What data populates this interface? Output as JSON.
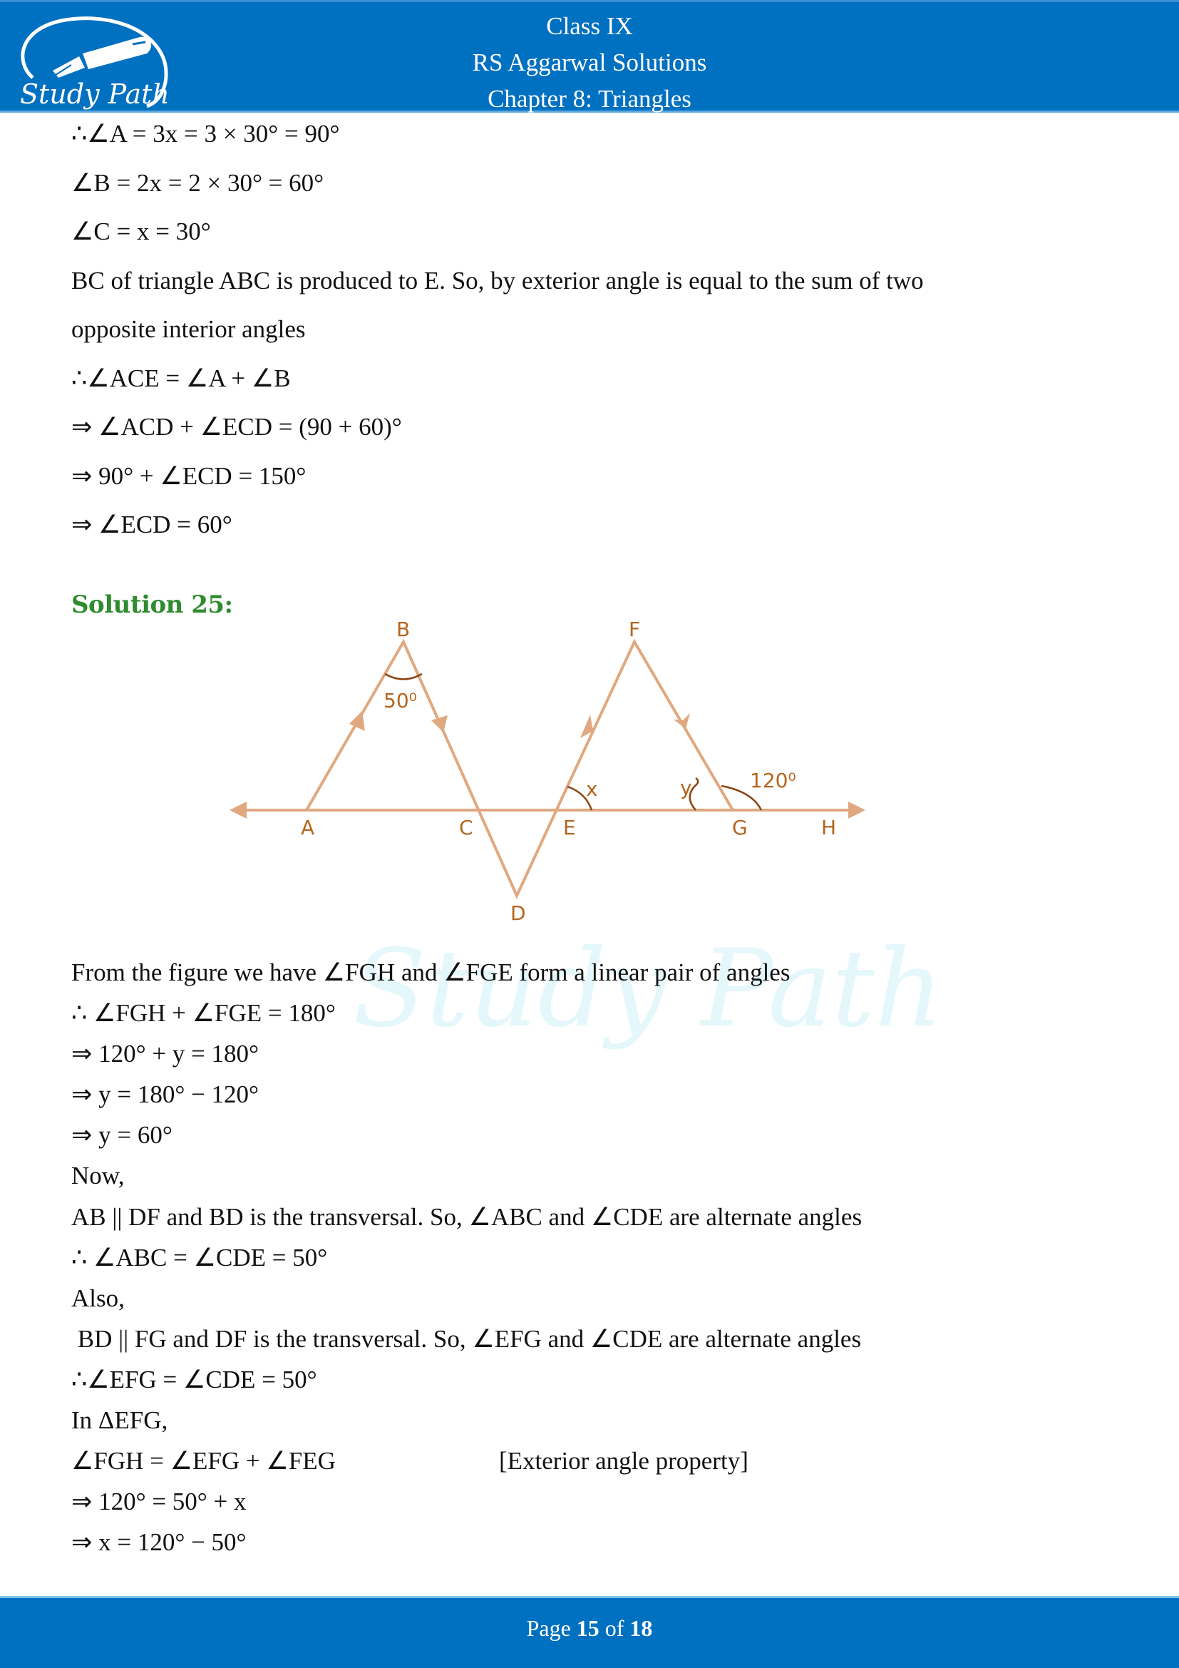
{
  "header": {
    "logo_text": "Study Path",
    "logo_icon": "fountain-pen-icon",
    "title_lines": [
      "Class IX",
      "RS Aggarwal Solutions",
      "Chapter 8: Triangles"
    ]
  },
  "previous_solution_lines": [
    "∴∠A = 3x = 3 × 30° = 90°",
    "∠B = 2x = 2 × 30° = 60°",
    "∠C = x = 30°",
    "BC of triangle ABC is produced to E. So, by exterior angle is equal to the sum of two",
    "opposite interior angles",
    "∴∠ACE = ∠A + ∠B",
    "⇒ ∠ACD + ∠ECD = (90 + 60)°",
    "⇒ 90° + ∠ECD = 150°",
    "⇒ ∠ECD = 60°"
  ],
  "solution": {
    "heading": "Solution 25:",
    "heading_color": "#2e8b2e",
    "figure": {
      "stroke_color": "#e0a880",
      "label_color": "#b5651d",
      "points": [
        "A",
        "B",
        "C",
        "D",
        "E",
        "F",
        "G",
        "H"
      ],
      "angle_labels": {
        "B": "50⁰",
        "E": "x",
        "G_interior": "y",
        "G_exterior": "120⁰"
      }
    },
    "lines": [
      "From the figure we have ∠FGH and ∠FGE form a linear pair of angles",
      "∴ ∠FGH + ∠FGE = 180°",
      "⇒ 120° + y = 180°",
      "⇒ y = 180° − 120°",
      "⇒ y = 60°",
      "Now,",
      "AB || DF and BD is the transversal. So, ∠ABC and ∠CDE are alternate angles",
      "∴ ∠ABC = ∠CDE = 50°",
      "Also,",
      " BD || FG and DF is the transversal. So, ∠EFG and ∠CDE are alternate angles",
      "∴∠EFG = ∠CDE = 50°",
      "In ΔEFG,",
      "∠FGH = ∠EFG + ∠FEG",
      "⇒ 120° = 50° + x",
      "⇒ x = 120° − 50°"
    ],
    "side_note": "[Exterior angle property]"
  },
  "watermark": "Study Path",
  "footer": {
    "prefix": "Page ",
    "current": "15",
    "middle": " of ",
    "total": "18"
  },
  "colors": {
    "brand_blue": "#0070c0"
  }
}
